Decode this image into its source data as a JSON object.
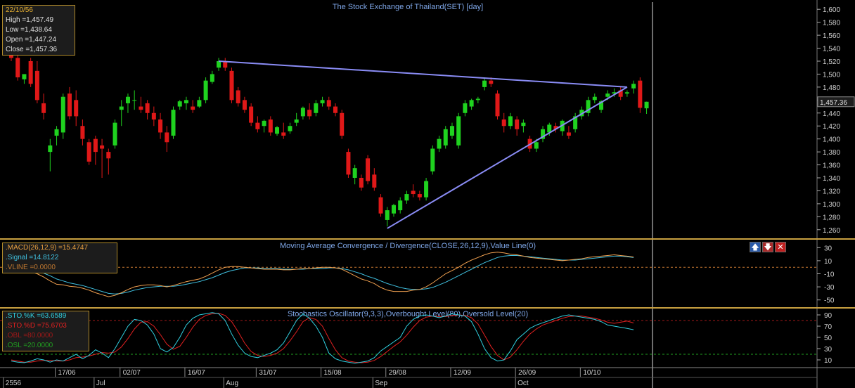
{
  "colors": {
    "up": "#1fd21f",
    "down": "#e01818",
    "trend": "#8a8cf5",
    "grid": "#3a3a3a",
    "panelLine": "#c8a040",
    "macd": "#f0a050",
    "signal": "#40c0e0",
    "vline": "#c87830",
    "stoK": "#30d0e0",
    "stoD": "#e02020",
    "obLevel": "#a01818",
    "osLevel": "#20a020",
    "axisText": "#d0d0d0"
  },
  "price_panel": {
    "title": "The Stock Exchange of Thailand(SET) [day]",
    "info": {
      "date": "22/10/56",
      "lines": [
        "High =1,457.49",
        "Low =1,438.64",
        "Open =1,447.24",
        "Close =1,457.36"
      ]
    },
    "last_price_label": "1,457.36"
  },
  "macd_panel": {
    "title": "Moving Average Convergence / Divergence(CLOSE,26,12,9),Value Line(0)",
    "info": [
      {
        "text": ".MACD(26,12,9) =15.4747",
        "color": "#e8a040"
      },
      {
        "text": ".Signal =14.8122",
        "color": "#40c0e0"
      },
      {
        "text": ".VLINE =0.0000",
        "color": "#c07830"
      }
    ],
    "buttons": [
      {
        "name": "move-up-icon",
        "glyph": "🡅",
        "bg": "#2a5aa8"
      },
      {
        "name": "move-down-icon",
        "glyph": "🡇",
        "bg": "#a82a2a"
      },
      {
        "name": "close-icon",
        "glyph": "✕",
        "bg": "#c02020"
      }
    ]
  },
  "sto_panel": {
    "title": "Stochastics Oscillator(9,3,3),Overbought Level(80),Oversold Level(20)",
    "info": [
      {
        "text": ".STO.%K =63.6589",
        "color": "#30d0e0"
      },
      {
        "text": ".STO.%D =75.6703",
        "color": "#e02020"
      },
      {
        "text": ".OBL =80.0000",
        "color": "#a01818"
      },
      {
        "text": ".OSL =20.0000",
        "color": "#20a020"
      }
    ]
  },
  "x_axis": {
    "date_labels": [
      {
        "label": "17/06",
        "index": 7
      },
      {
        "label": "02/07",
        "index": 17
      },
      {
        "label": "16/07",
        "index": 27
      },
      {
        "label": "31/07",
        "index": 38
      },
      {
        "label": "15/08",
        "index": 48
      },
      {
        "label": "29/08",
        "index": 58
      },
      {
        "label": "12/09",
        "index": 68
      },
      {
        "label": "26/09",
        "index": 78
      },
      {
        "label": "10/10",
        "index": 88
      }
    ],
    "month_labels": [
      {
        "label": "2556",
        "index": -1
      },
      {
        "label": "Jul",
        "index": 13
      },
      {
        "label": "Aug",
        "index": 33
      },
      {
        "label": "Sep",
        "index": 56
      },
      {
        "label": "Oct",
        "index": 78
      }
    ]
  },
  "chart_data": [
    {
      "type": "candlestick",
      "title": "The Stock Exchange of Thailand(SET) [day]",
      "ylim": [
        1250,
        1610
      ],
      "y_ticks": [
        1260,
        1280,
        1300,
        1320,
        1340,
        1360,
        1380,
        1400,
        1420,
        1440,
        1460,
        1480,
        1500,
        1520,
        1540,
        1560,
        1580,
        1600
      ],
      "ohlc": [
        [
          1530,
          1540,
          1520,
          1525
        ],
        [
          1525,
          1530,
          1490,
          1495
        ],
        [
          1492,
          1500,
          1485,
          1500
        ],
        [
          1520,
          1525,
          1480,
          1485
        ],
        [
          1505,
          1520,
          1455,
          1460
        ],
        [
          1455,
          1470,
          1430,
          1440
        ],
        [
          1380,
          1400,
          1350,
          1390
        ],
        [
          1405,
          1420,
          1390,
          1415
        ],
        [
          1410,
          1470,
          1400,
          1465
        ],
        [
          1470,
          1480,
          1430,
          1435
        ],
        [
          1460,
          1475,
          1420,
          1435
        ],
        [
          1420,
          1430,
          1390,
          1400
        ],
        [
          1395,
          1400,
          1360,
          1365
        ],
        [
          1400,
          1405,
          1360,
          1380
        ],
        [
          1390,
          1400,
          1340,
          1385
        ],
        [
          1380,
          1385,
          1345,
          1370
        ],
        [
          1390,
          1430,
          1385,
          1425
        ],
        [
          1445,
          1460,
          1420,
          1450
        ],
        [
          1455,
          1470,
          1440,
          1465
        ],
        [
          1460,
          1475,
          1445,
          1460
        ],
        [
          1450,
          1465,
          1440,
          1445
        ],
        [
          1455,
          1460,
          1430,
          1440
        ],
        [
          1440,
          1450,
          1420,
          1430
        ],
        [
          1430,
          1440,
          1400,
          1410
        ],
        [
          1410,
          1420,
          1380,
          1395
        ],
        [
          1405,
          1450,
          1400,
          1445
        ],
        [
          1450,
          1460,
          1445,
          1458
        ],
        [
          1455,
          1465,
          1445,
          1460
        ],
        [
          1450,
          1460,
          1440,
          1445
        ],
        [
          1450,
          1465,
          1448,
          1460
        ],
        [
          1460,
          1495,
          1455,
          1490
        ],
        [
          1488,
          1505,
          1485,
          1500
        ],
        [
          1510,
          1525,
          1505,
          1520
        ],
        [
          1520,
          1525,
          1505,
          1510
        ],
        [
          1505,
          1510,
          1455,
          1460
        ],
        [
          1475,
          1480,
          1450,
          1455
        ],
        [
          1460,
          1465,
          1440,
          1445
        ],
        [
          1450,
          1455,
          1420,
          1425
        ],
        [
          1425,
          1435,
          1410,
          1415
        ],
        [
          1420,
          1430,
          1410,
          1428
        ],
        [
          1430,
          1435,
          1405,
          1410
        ],
        [
          1408,
          1420,
          1405,
          1418
        ],
        [
          1410,
          1425,
          1400,
          1405
        ],
        [
          1412,
          1425,
          1408,
          1420
        ],
        [
          1425,
          1440,
          1420,
          1430
        ],
        [
          1435,
          1450,
          1430,
          1448
        ],
        [
          1445,
          1455,
          1430,
          1435
        ],
        [
          1440,
          1460,
          1435,
          1455
        ],
        [
          1455,
          1465,
          1450,
          1460
        ],
        [
          1460,
          1465,
          1445,
          1450
        ],
        [
          1450,
          1455,
          1435,
          1440
        ],
        [
          1440,
          1445,
          1400,
          1405
        ],
        [
          1380,
          1385,
          1340,
          1345
        ],
        [
          1340,
          1360,
          1330,
          1355
        ],
        [
          1340,
          1345,
          1320,
          1325
        ],
        [
          1370,
          1375,
          1330,
          1335
        ],
        [
          1345,
          1355,
          1320,
          1325
        ],
        [
          1310,
          1315,
          1280,
          1285
        ],
        [
          1275,
          1295,
          1265,
          1290
        ],
        [
          1285,
          1300,
          1280,
          1298
        ],
        [
          1290,
          1310,
          1285,
          1305
        ],
        [
          1305,
          1320,
          1300,
          1315
        ],
        [
          1320,
          1330,
          1310,
          1315
        ],
        [
          1315,
          1320,
          1305,
          1310
        ],
        [
          1310,
          1340,
          1305,
          1335
        ],
        [
          1350,
          1390,
          1345,
          1385
        ],
        [
          1385,
          1405,
          1380,
          1400
        ],
        [
          1390,
          1420,
          1385,
          1415
        ],
        [
          1405,
          1425,
          1400,
          1420
        ],
        [
          1390,
          1440,
          1385,
          1435
        ],
        [
          1440,
          1460,
          1435,
          1455
        ],
        [
          1450,
          1462,
          1445,
          1460
        ],
        [
          1460,
          1465,
          1455,
          1462
        ],
        [
          1480,
          1495,
          1475,
          1490
        ],
        [
          1490,
          1495,
          1480,
          1485
        ],
        [
          1470,
          1475,
          1430,
          1435
        ],
        [
          1430,
          1440,
          1410,
          1420
        ],
        [
          1420,
          1440,
          1415,
          1435
        ],
        [
          1430,
          1435,
          1405,
          1415
        ],
        [
          1420,
          1430,
          1410,
          1425
        ],
        [
          1400,
          1405,
          1380,
          1385
        ],
        [
          1385,
          1400,
          1380,
          1395
        ],
        [
          1400,
          1420,
          1395,
          1415
        ],
        [
          1410,
          1425,
          1405,
          1422
        ],
        [
          1420,
          1425,
          1410,
          1415
        ],
        [
          1412,
          1430,
          1405,
          1428
        ],
        [
          1410,
          1420,
          1400,
          1405
        ],
        [
          1415,
          1440,
          1410,
          1435
        ],
        [
          1435,
          1450,
          1430,
          1445
        ],
        [
          1440,
          1465,
          1435,
          1460
        ],
        [
          1460,
          1470,
          1455,
          1465
        ],
        [
          1445,
          1460,
          1440,
          1458
        ],
        [
          1465,
          1475,
          1460,
          1470
        ],
        [
          1470,
          1478,
          1465,
          1472
        ],
        [
          1475,
          1480,
          1460,
          1465
        ],
        [
          1470,
          1475,
          1465,
          1472
        ],
        [
          1478,
          1490,
          1470,
          1485
        ],
        [
          1490,
          1495,
          1440,
          1448
        ],
        [
          1447.24,
          1457.49,
          1438.64,
          1457.36
        ]
      ],
      "trendlines": [
        {
          "from": [
            32,
            1520
          ],
          "to": [
            95,
            1480
          ]
        },
        {
          "from": [
            58,
            1262
          ],
          "to": [
            95,
            1480
          ]
        }
      ]
    },
    {
      "type": "line",
      "title": "Moving Average Convergence / Divergence(CLOSE,26,12,9),Value Line(0)",
      "ylim": [
        -60,
        40
      ],
      "y_ticks": [
        -50,
        -30,
        -10,
        10,
        30
      ],
      "series": [
        {
          "name": ".MACD(26,12,9)",
          "values": [
            2,
            -1,
            -4,
            -7,
            -10,
            -15,
            -21,
            -26,
            -27,
            -29,
            -30,
            -32,
            -35,
            -39,
            -42,
            -45,
            -43,
            -39,
            -34,
            -30,
            -28,
            -27,
            -27,
            -28,
            -30,
            -28,
            -25,
            -22,
            -20,
            -18,
            -14,
            -9,
            -4,
            0,
            1,
            1,
            0,
            -1,
            -2,
            -3,
            -3,
            -3,
            -4,
            -4,
            -3,
            -2,
            -2,
            -1,
            0,
            0,
            -1,
            -3,
            -8,
            -13,
            -18,
            -21,
            -25,
            -31,
            -35,
            -37,
            -37,
            -37,
            -35,
            -34,
            -30,
            -24,
            -17,
            -10,
            -5,
            0,
            6,
            11,
            15,
            19,
            22,
            23,
            22,
            20,
            19,
            17,
            15,
            14,
            13,
            12,
            11,
            10,
            11,
            12,
            13,
            15,
            16,
            17,
            18,
            19,
            18,
            17,
            15.4747
          ]
        },
        {
          "name": ".Signal",
          "values": [
            4,
            2,
            0,
            -2,
            -5,
            -9,
            -13,
            -18,
            -21,
            -24,
            -26,
            -28,
            -31,
            -34,
            -37,
            -40,
            -41,
            -40,
            -38,
            -35,
            -33,
            -31,
            -30,
            -29,
            -29,
            -29,
            -28,
            -26,
            -24,
            -22,
            -19,
            -16,
            -12,
            -8,
            -5,
            -3,
            -1,
            -1,
            -1,
            -2,
            -2,
            -2,
            -3,
            -3,
            -3,
            -3,
            -2,
            -2,
            -2,
            -1,
            -1,
            -2,
            -4,
            -7,
            -10,
            -14,
            -17,
            -21,
            -25,
            -28,
            -31,
            -33,
            -34,
            -34,
            -33,
            -31,
            -27,
            -23,
            -18,
            -13,
            -8,
            -3,
            2,
            7,
            11,
            15,
            17,
            18,
            18,
            17,
            16,
            15,
            14,
            13,
            12,
            11,
            11,
            11,
            12,
            13,
            14,
            15,
            16,
            17,
            17,
            16,
            14.8122
          ]
        },
        {
          "name": ".VLINE",
          "values": [
            0
          ]
        }
      ]
    },
    {
      "type": "line",
      "title": "Stochastics Oscillator(9,3,3),Overbought Level(80),Oversold Level(20)",
      "ylim": [
        0,
        100
      ],
      "y_ticks": [
        10,
        30,
        50,
        70,
        90
      ],
      "series": [
        {
          "name": ".STO.%K",
          "values": [
            8,
            6,
            5,
            8,
            12,
            10,
            6,
            10,
            8,
            14,
            20,
            12,
            18,
            28,
            22,
            14,
            30,
            50,
            70,
            82,
            80,
            72,
            56,
            30,
            24,
            32,
            50,
            72,
            84,
            90,
            92,
            94,
            92,
            80,
            56,
            36,
            22,
            16,
            14,
            18,
            22,
            28,
            40,
            60,
            80,
            92,
            84,
            70,
            50,
            22,
            12,
            8,
            6,
            4,
            6,
            8,
            14,
            26,
            34,
            42,
            50,
            70,
            82,
            88,
            90,
            88,
            85,
            88,
            92,
            90,
            88,
            78,
            56,
            30,
            14,
            8,
            10,
            26,
            46,
            56,
            66,
            72,
            76,
            80,
            84,
            88,
            90,
            88,
            86,
            84,
            82,
            78,
            72,
            70,
            68,
            66,
            63.6589
          ]
        },
        {
          "name": ".STO.%D",
          "values": [
            10,
            8,
            6,
            6,
            8,
            9,
            9,
            8,
            8,
            10,
            14,
            15,
            17,
            20,
            23,
            22,
            24,
            33,
            48,
            65,
            77,
            78,
            70,
            55,
            38,
            29,
            34,
            50,
            68,
            82,
            89,
            92,
            93,
            89,
            78,
            60,
            40,
            25,
            18,
            16,
            18,
            22,
            30,
            44,
            60,
            78,
            85,
            82,
            70,
            48,
            28,
            14,
            8,
            6,
            5,
            6,
            9,
            16,
            25,
            34,
            42,
            54,
            68,
            80,
            86,
            88,
            87,
            87,
            89,
            90,
            89,
            85,
            74,
            54,
            34,
            18,
            10,
            15,
            28,
            43,
            56,
            65,
            72,
            76,
            80,
            84,
            87,
            88,
            88,
            86,
            84,
            81,
            77,
            75,
            77,
            79,
            75.6703
          ]
        },
        {
          "name": ".OBL",
          "values": [
            80
          ]
        },
        {
          "name": ".OSL",
          "values": [
            20
          ]
        }
      ]
    }
  ]
}
